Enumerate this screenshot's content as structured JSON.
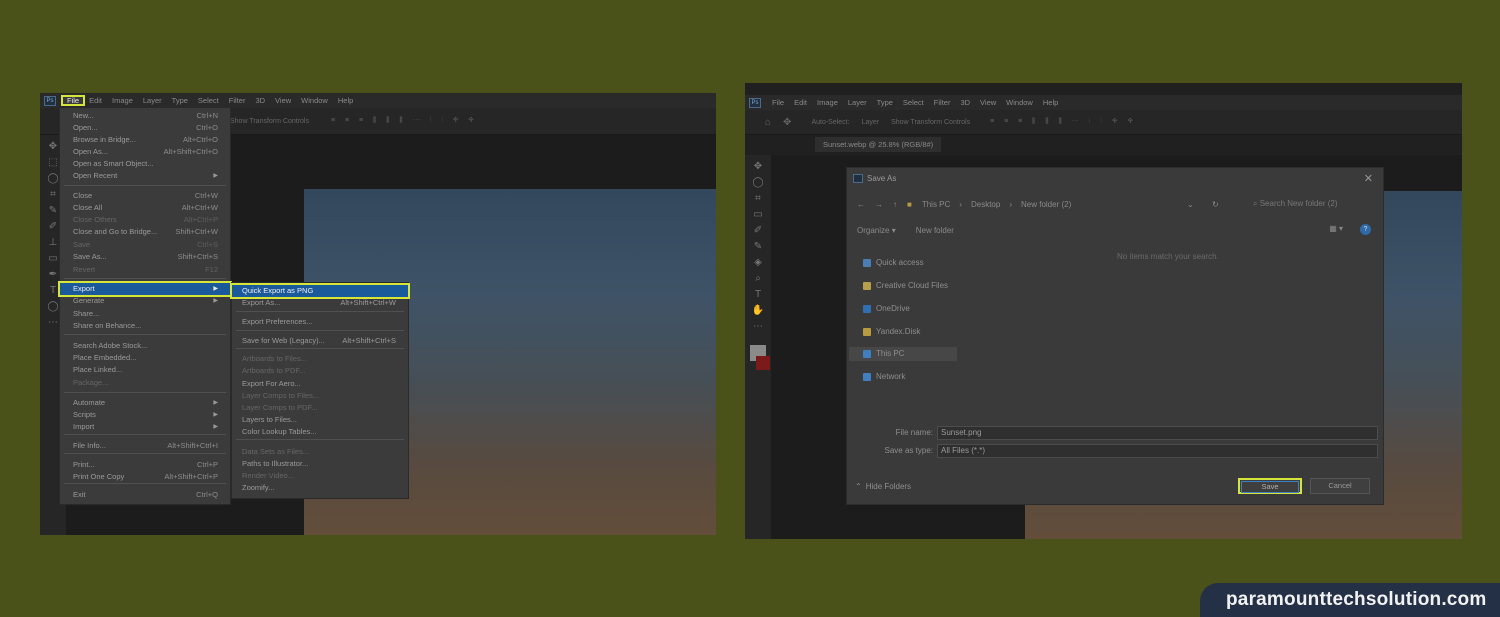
{
  "left": {
    "menubar": [
      "File",
      "Edit",
      "Image",
      "Layer",
      "Type",
      "Select",
      "Filter",
      "3D",
      "View",
      "Window",
      "Help"
    ],
    "options_text": "Show Transform Controls",
    "file_menu": [
      {
        "label": "New...",
        "shortcut": "Ctrl+N",
        "disabled": false
      },
      {
        "label": "Open...",
        "shortcut": "Ctrl+O",
        "disabled": false
      },
      {
        "label": "Browse in Bridge...",
        "shortcut": "Alt+Ctrl+O",
        "disabled": false
      },
      {
        "label": "Open As...",
        "shortcut": "Alt+Shift+Ctrl+O",
        "disabled": false
      },
      {
        "label": "Open as Smart Object...",
        "shortcut": "",
        "disabled": false
      },
      {
        "label": "Open Recent",
        "shortcut": "",
        "disabled": false,
        "submenu": true
      },
      {
        "label": "Close",
        "shortcut": "Ctrl+W",
        "disabled": false
      },
      {
        "label": "Close All",
        "shortcut": "Alt+Ctrl+W",
        "disabled": false
      },
      {
        "label": "Close Others",
        "shortcut": "Alt+Ctrl+P",
        "disabled": true
      },
      {
        "label": "Close and Go to Bridge...",
        "shortcut": "Shift+Ctrl+W",
        "disabled": false
      },
      {
        "label": "Save",
        "shortcut": "Ctrl+S",
        "disabled": true
      },
      {
        "label": "Save As...",
        "shortcut": "Shift+Ctrl+S",
        "disabled": false
      },
      {
        "label": "Revert",
        "shortcut": "F12",
        "disabled": true
      },
      {
        "label": "Export",
        "shortcut": "",
        "disabled": false,
        "submenu": true,
        "highlighted": true
      },
      {
        "label": "Generate",
        "shortcut": "",
        "disabled": false,
        "submenu": true
      },
      {
        "label": "Share...",
        "shortcut": "",
        "disabled": false
      },
      {
        "label": "Share on Behance...",
        "shortcut": "",
        "disabled": false
      },
      {
        "label": "Search Adobe Stock...",
        "shortcut": "",
        "disabled": false
      },
      {
        "label": "Place Embedded...",
        "shortcut": "",
        "disabled": false
      },
      {
        "label": "Place Linked...",
        "shortcut": "",
        "disabled": false
      },
      {
        "label": "Package...",
        "shortcut": "",
        "disabled": true
      },
      {
        "label": "Automate",
        "shortcut": "",
        "disabled": false,
        "submenu": true
      },
      {
        "label": "Scripts",
        "shortcut": "",
        "disabled": false,
        "submenu": true
      },
      {
        "label": "Import",
        "shortcut": "",
        "disabled": false,
        "submenu": true
      },
      {
        "label": "File Info...",
        "shortcut": "Alt+Shift+Ctrl+I",
        "disabled": false
      },
      {
        "label": "Print...",
        "shortcut": "Ctrl+P",
        "disabled": false
      },
      {
        "label": "Print One Copy",
        "shortcut": "Alt+Shift+Ctrl+P",
        "disabled": false
      },
      {
        "label": "Exit",
        "shortcut": "Ctrl+Q",
        "disabled": false
      }
    ],
    "export_menu": [
      {
        "label": "Quick Export as PNG",
        "shortcut": "",
        "disabled": false,
        "highlighted": true
      },
      {
        "label": "Export As...",
        "shortcut": "Alt+Shift+Ctrl+W",
        "disabled": false
      },
      {
        "label": "Export Preferences...",
        "shortcut": "",
        "disabled": false
      },
      {
        "label": "Save for Web (Legacy)...",
        "shortcut": "Alt+Shift+Ctrl+S",
        "disabled": false
      },
      {
        "label": "Artboards to Files...",
        "shortcut": "",
        "disabled": true
      },
      {
        "label": "Artboards to PDF...",
        "shortcut": "",
        "disabled": true
      },
      {
        "label": "Export For Aero...",
        "shortcut": "",
        "disabled": false
      },
      {
        "label": "Layer Comps to Files...",
        "shortcut": "",
        "disabled": true
      },
      {
        "label": "Layer Comps to PDF...",
        "shortcut": "",
        "disabled": true
      },
      {
        "label": "Layers to Files...",
        "shortcut": "",
        "disabled": false
      },
      {
        "label": "Color Lookup Tables...",
        "shortcut": "",
        "disabled": false
      },
      {
        "label": "Data Sets as Files...",
        "shortcut": "",
        "disabled": true
      },
      {
        "label": "Paths to Illustrator...",
        "shortcut": "",
        "disabled": false
      },
      {
        "label": "Render Video...",
        "shortcut": "",
        "disabled": true
      },
      {
        "label": "Zoomify...",
        "shortcut": "",
        "disabled": false
      }
    ]
  },
  "right": {
    "menubar": [
      "File",
      "Edit",
      "Image",
      "Layer",
      "Type",
      "Select",
      "Filter",
      "3D",
      "View",
      "Window",
      "Help"
    ],
    "options": {
      "auto_select": "Auto-Select:",
      "layer": "Layer",
      "transform": "Show Transform Controls"
    },
    "doc_tab": "Sunset.webp @ 25.8% (RGB/8#)",
    "dialog": {
      "title": "Save As",
      "breadcrumbs": [
        "This PC",
        "Desktop",
        "New folder (2)"
      ],
      "search_placeholder": "Search New folder (2)",
      "organize": "Organize",
      "new_folder": "New folder",
      "empty_message": "No items match your search.",
      "nav_items": [
        {
          "label": "Quick access",
          "icon": "star-icon",
          "color": "#4a7fb5"
        },
        {
          "label": "Creative Cloud Files",
          "icon": "cloud-folder-icon",
          "color": "#b8a04a"
        },
        {
          "label": "OneDrive",
          "icon": "onedrive-icon",
          "color": "#2f6fb2"
        },
        {
          "label": "Yandex.Disk",
          "icon": "yandex-disk-icon",
          "color": "#b89a40"
        },
        {
          "label": "This PC",
          "icon": "computer-icon",
          "color": "#3f7fbf",
          "selected": true
        },
        {
          "label": "Network",
          "icon": "network-icon",
          "color": "#3f7fbf"
        }
      ],
      "file_name_label": "File name:",
      "file_name_value": "Sunset.png",
      "save_type_label": "Save as type:",
      "save_type_value": "All Files (*.*)",
      "hide_folders": "Hide Folders",
      "save_button": "Save",
      "cancel_button": "Cancel"
    }
  },
  "brand": "paramounttechsolution.com",
  "colors": {
    "background": "#4a5119",
    "highlight": "#d6e53a",
    "selection": "#1b5a9a",
    "brand_bg": "#243046"
  }
}
